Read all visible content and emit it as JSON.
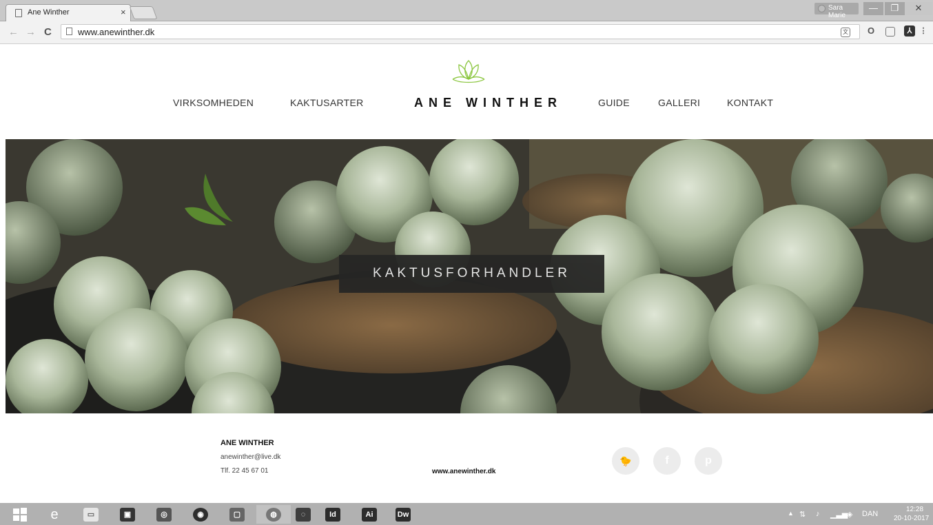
{
  "browser": {
    "tab_title": "Ane Winther",
    "tab_close": "×",
    "user_name": "Sara Marie",
    "window_controls": {
      "minimize": "—",
      "maximize": "❐",
      "close": "✕"
    },
    "nav": {
      "back": "←",
      "forward": "→",
      "reload": "C"
    },
    "url": "www.anewinther.dk",
    "extension_icons": [
      "translate-icon",
      "opera-icon",
      "pocket-icon",
      "pdf-icon",
      "menu-icon"
    ]
  },
  "site": {
    "logo_text": "ANE WINTHER",
    "nav_left": [
      "VIRKSOMHEDEN",
      "KAKTUSARTER"
    ],
    "nav_right": [
      "GUIDE",
      "GALLERI",
      "KONTAKT"
    ],
    "hero_title": "KAKTUSFORHANDLER",
    "accent_color": "#8bc63f"
  },
  "footer": {
    "name": "ANE WINTHER",
    "email": "anewinther@live.dk",
    "phone": "Tlf. 22 45 67 01",
    "website": "www.anewinther.dk",
    "social": [
      {
        "icon": "twitter-icon",
        "glyph": "🐦"
      },
      {
        "icon": "facebook-icon",
        "glyph": "f"
      },
      {
        "icon": "pinterest-icon",
        "glyph": "p"
      }
    ]
  },
  "taskbar": {
    "apps": [
      {
        "name": "edge",
        "label": "e"
      },
      {
        "name": "file-explorer",
        "label": "▭"
      },
      {
        "name": "store",
        "label": "▣"
      },
      {
        "name": "disk",
        "label": "◎"
      },
      {
        "name": "media-player",
        "label": "◉"
      },
      {
        "name": "photos",
        "label": "▢"
      },
      {
        "name": "chrome",
        "label": "◍"
      },
      {
        "name": "creative-cloud",
        "label": "◌"
      },
      {
        "name": "indesign",
        "label": "Id"
      },
      {
        "name": "illustrator",
        "label": "Ai"
      },
      {
        "name": "dreamweaver",
        "label": "Dw"
      }
    ],
    "language": "DAN",
    "time": "12:28",
    "date": "20-10-2017"
  }
}
